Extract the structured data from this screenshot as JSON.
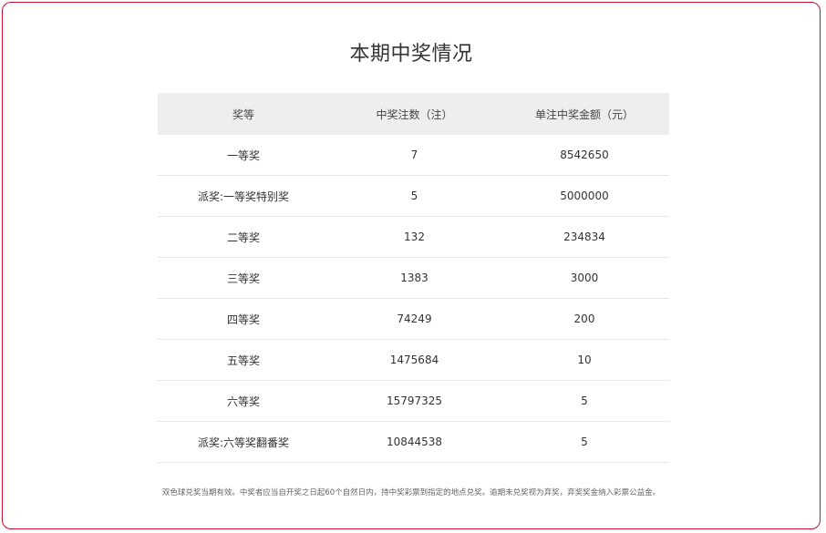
{
  "title": "本期中奖情况",
  "table": {
    "headers": [
      "奖等",
      "中奖注数（注）",
      "单注中奖金额（元）"
    ],
    "rows": [
      [
        "一等奖",
        "7",
        "8542650"
      ],
      [
        "派奖:一等奖特别奖",
        "5",
        "5000000"
      ],
      [
        "二等奖",
        "132",
        "234834"
      ],
      [
        "三等奖",
        "1383",
        "3000"
      ],
      [
        "四等奖",
        "74249",
        "200"
      ],
      [
        "五等奖",
        "1475684",
        "10"
      ],
      [
        "六等奖",
        "15797325",
        "5"
      ],
      [
        "派奖:六等奖翻番奖",
        "10844538",
        "5"
      ]
    ]
  },
  "note": "双色球兑奖当期有效。中奖者应当自开奖之日起60个自然日内，持中奖彩票到指定的地点兑奖。逾期未兑奖视为弃奖，弃奖奖金纳入彩票公益金。",
  "colors": {
    "border": "#c8102e",
    "header_bg": "#eeeeee"
  }
}
